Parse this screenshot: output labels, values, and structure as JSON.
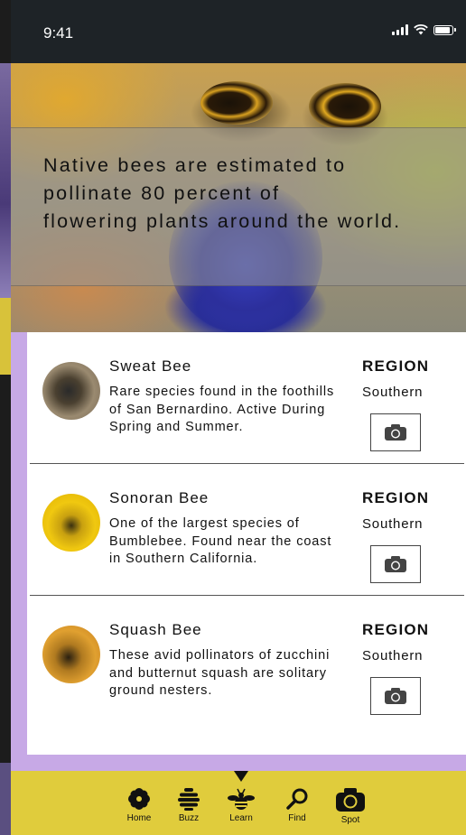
{
  "status_bar": {
    "time": "9:41"
  },
  "hero": {
    "text": "Native bees are estimated to\npollinate 80 percent of\nflowering plants around the world."
  },
  "bees": [
    {
      "name": "Sweat Bee",
      "description": "Rare species found in the foothills of San Bernardino. Active During Spring and Summer.",
      "region_label": "REGION",
      "region": "Southern"
    },
    {
      "name": "Sonoran Bee",
      "description": "One of the largest species of Bumblebee. Found near the coast in Southern California.",
      "region_label": "REGION",
      "region": "Southern"
    },
    {
      "name": "Squash Bee",
      "description": "These avid pollinators of zucchini and butternut squash are solitary ground nesters.",
      "region_label": "REGION",
      "region": "Southern"
    }
  ],
  "nav": {
    "items": [
      {
        "label": "Home",
        "icon": "flower-icon"
      },
      {
        "label": "Buzz",
        "icon": "hive-icon"
      },
      {
        "label": "Learn",
        "icon": "bee-icon"
      },
      {
        "label": "Find",
        "icon": "search-icon"
      },
      {
        "label": "Spot",
        "icon": "camera-icon"
      }
    ],
    "active": "Learn"
  },
  "colors": {
    "nav_background": "#e0cc3c",
    "accent_purple": "#c7a9e6",
    "status_bar": "#1e2327"
  }
}
